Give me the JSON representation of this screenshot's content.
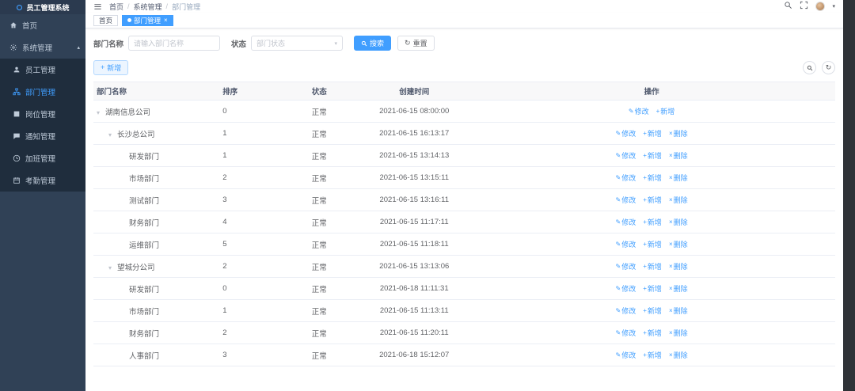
{
  "app": {
    "logo": "员工管理系统"
  },
  "sidebar": {
    "home_label": "首页",
    "group_label": "系统管理",
    "items": [
      {
        "label": "员工管理",
        "icon": "user-icon",
        "active": false
      },
      {
        "label": "部门管理",
        "icon": "tree-icon",
        "active": true
      },
      {
        "label": "岗位管理",
        "icon": "post-icon",
        "active": false
      },
      {
        "label": "通知管理",
        "icon": "message-icon",
        "active": false
      },
      {
        "label": "加班管理",
        "icon": "clock-icon",
        "active": false
      },
      {
        "label": "考勤管理",
        "icon": "calendar-icon",
        "active": false
      }
    ]
  },
  "breadcrumb": [
    "首页",
    "系统管理",
    "部门管理"
  ],
  "tabs": [
    {
      "label": "首页",
      "active": false
    },
    {
      "label": "部门管理",
      "active": true
    }
  ],
  "filters": {
    "name_label": "部门名称",
    "name_placeholder": "请输入部门名称",
    "status_label": "状态",
    "status_placeholder": "部门状态",
    "search_label": "搜索",
    "reset_label": "重置"
  },
  "toolbar": {
    "add_label": "新增"
  },
  "table": {
    "columns": {
      "name": "部门名称",
      "sort": "排序",
      "status": "状态",
      "created": "创建时间",
      "ops": "操作"
    },
    "action_labels": {
      "edit": "修改",
      "add": "新增",
      "delete": "删除"
    },
    "rows": [
      {
        "name": "湖南信息公司",
        "level": 0,
        "expandable": true,
        "sort": "0",
        "status": "正常",
        "created": "2021-06-15 08:00:00",
        "actions": [
          "edit",
          "add"
        ]
      },
      {
        "name": "长沙总公司",
        "level": 1,
        "expandable": true,
        "sort": "1",
        "status": "正常",
        "created": "2021-06-15 16:13:17",
        "actions": [
          "edit",
          "add",
          "delete"
        ]
      },
      {
        "name": "研发部门",
        "level": 2,
        "expandable": false,
        "sort": "1",
        "status": "正常",
        "created": "2021-06-15 13:14:13",
        "actions": [
          "edit",
          "add",
          "delete"
        ]
      },
      {
        "name": "市场部门",
        "level": 2,
        "expandable": false,
        "sort": "2",
        "status": "正常",
        "created": "2021-06-15 13:15:11",
        "actions": [
          "edit",
          "add",
          "delete"
        ]
      },
      {
        "name": "测试部门",
        "level": 2,
        "expandable": false,
        "sort": "3",
        "status": "正常",
        "created": "2021-06-15 13:16:11",
        "actions": [
          "edit",
          "add",
          "delete"
        ]
      },
      {
        "name": "财务部门",
        "level": 2,
        "expandable": false,
        "sort": "4",
        "status": "正常",
        "created": "2021-06-15 11:17:11",
        "actions": [
          "edit",
          "add",
          "delete"
        ]
      },
      {
        "name": "运维部门",
        "level": 2,
        "expandable": false,
        "sort": "5",
        "status": "正常",
        "created": "2021-06-15 11:18:11",
        "actions": [
          "edit",
          "add",
          "delete"
        ]
      },
      {
        "name": "望城分公司",
        "level": 1,
        "expandable": true,
        "sort": "2",
        "status": "正常",
        "created": "2021-06-15 13:13:06",
        "actions": [
          "edit",
          "add",
          "delete"
        ]
      },
      {
        "name": "研发部门",
        "level": 2,
        "expandable": false,
        "sort": "0",
        "status": "正常",
        "created": "2021-06-18 11:11:31",
        "actions": [
          "edit",
          "add",
          "delete"
        ]
      },
      {
        "name": "市场部门",
        "level": 2,
        "expandable": false,
        "sort": "1",
        "status": "正常",
        "created": "2021-06-15 11:13:11",
        "actions": [
          "edit",
          "add",
          "delete"
        ]
      },
      {
        "name": "财务部门",
        "level": 2,
        "expandable": false,
        "sort": "2",
        "status": "正常",
        "created": "2021-06-15 11:20:11",
        "actions": [
          "edit",
          "add",
          "delete"
        ]
      },
      {
        "name": "人事部门",
        "level": 2,
        "expandable": false,
        "sort": "3",
        "status": "正常",
        "created": "2021-06-18 15:12:07",
        "actions": [
          "edit",
          "add",
          "delete"
        ]
      }
    ]
  },
  "colors": {
    "primary": "#409eff",
    "sidebar_bg": "#304156",
    "submenu_bg": "#1f2d3d"
  }
}
